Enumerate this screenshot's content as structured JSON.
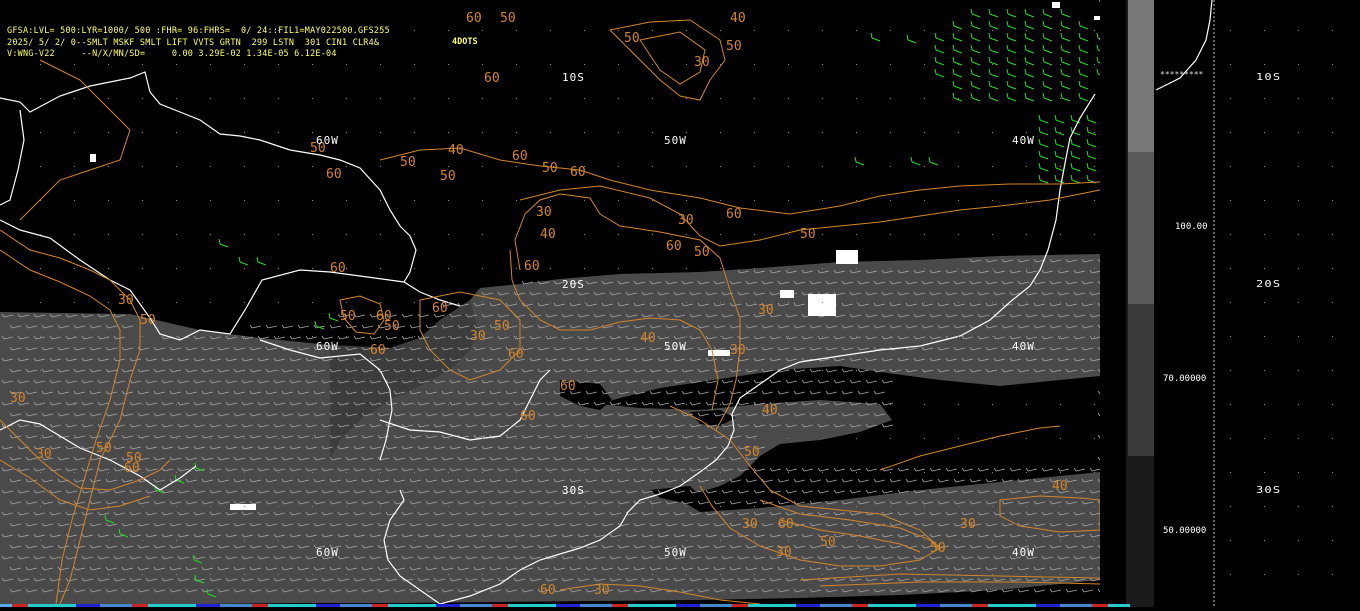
{
  "header": {
    "line1": "GFSA:LVL= 500:LYR=1000/ 500 :FHR= 96:FHRS=  0/ 24::FIL1=MAY022500.GFS255",
    "line2": "2025/ 5/ 2/ 0--SMLT MSKF SMLT LIFT VVTS GRTN  299 LSTN  301 CIN1 CLR4&",
    "line3": "V:WNG-V22     --N/X/MN/SD=     0.00 3.29E-02 1.34E-05 6.12E-04",
    "dots": "4DOTS"
  },
  "grid_labels": {
    "lon_60w": "60W",
    "lon_50w": "50W",
    "lon_40w": "40W",
    "lat_10s": "10S",
    "lat_20s": "20S",
    "lat_30s": "30S"
  },
  "contour_labels": [
    "30",
    "40",
    "50",
    "60"
  ],
  "scale": {
    "labels": [
      "100.00",
      "70.00000",
      "50.00000"
    ],
    "shades": [
      "#777777",
      "#5a5a5a",
      "#3a3a3a"
    ]
  },
  "side_lat_labels": [
    "10S",
    "20S",
    "30S"
  ],
  "stars": "*********",
  "colors": {
    "background": "#000000",
    "coast": "#ffffff",
    "contour": "#d4862a",
    "shade": "#4a4a4a",
    "barb_shaded": "#a8a8a8",
    "barb_green": "#22dd22",
    "header_text": "#ffff66"
  }
}
